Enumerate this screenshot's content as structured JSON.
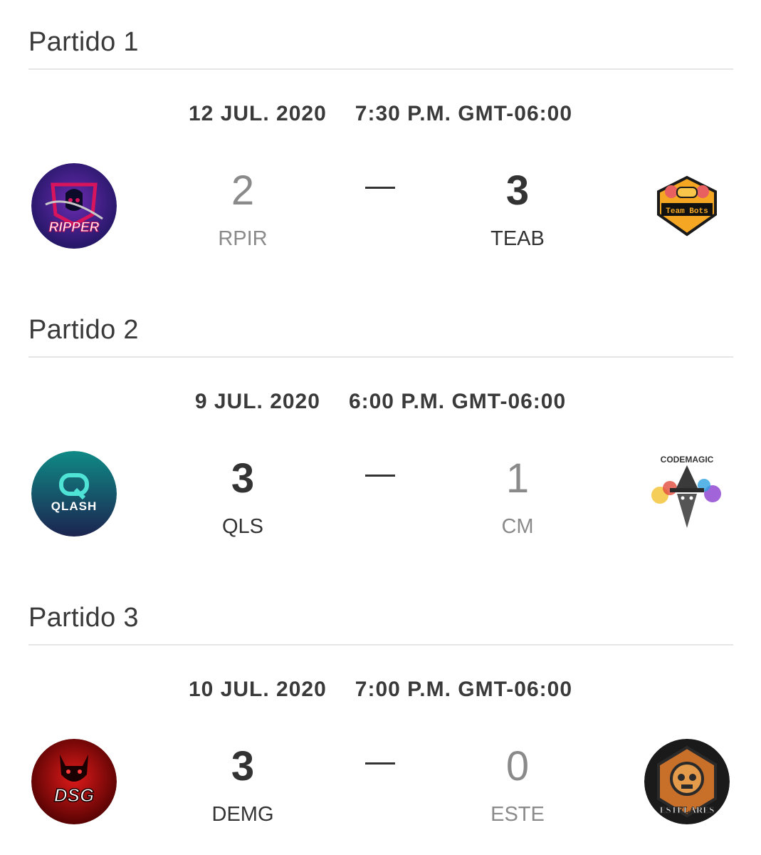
{
  "matches": [
    {
      "title": "Partido 1",
      "date": "12 JUL. 2020",
      "time": "7:30 P.M. GMT-06:00",
      "home": {
        "abbr": "RPIR",
        "score": "2",
        "result": "lose",
        "logo_text": "RIPPER",
        "logo_colors": [
          "#2a1a6e",
          "#c4125a"
        ]
      },
      "away": {
        "abbr": "TEAB",
        "score": "3",
        "result": "win",
        "logo_text": "Team Bots",
        "logo_colors": [
          "#f5a623",
          "#111111"
        ]
      }
    },
    {
      "title": "Partido 2",
      "date": "9 JUL. 2020",
      "time": "6:00 P.M. GMT-06:00",
      "home": {
        "abbr": "QLS",
        "score": "3",
        "result": "win",
        "logo_text": "QLASH",
        "logo_colors": [
          "#0f8a86",
          "#1c2450"
        ]
      },
      "away": {
        "abbr": "CM",
        "score": "1",
        "result": "lose",
        "logo_text": "CODEMAGIC",
        "logo_colors": [
          "#ffffff",
          "#333333"
        ]
      }
    },
    {
      "title": "Partido 3",
      "date": "10 JUL. 2020",
      "time": "7:00 P.M. GMT-06:00",
      "home": {
        "abbr": "DEMG",
        "score": "3",
        "result": "win",
        "logo_text": "DSG",
        "logo_colors": [
          "#b10e0e",
          "#2a0000"
        ]
      },
      "away": {
        "abbr": "ESTE",
        "score": "0",
        "result": "lose",
        "logo_text": "ESTELARES",
        "logo_colors": [
          "#c8702a",
          "#1a1a1a"
        ]
      }
    }
  ]
}
